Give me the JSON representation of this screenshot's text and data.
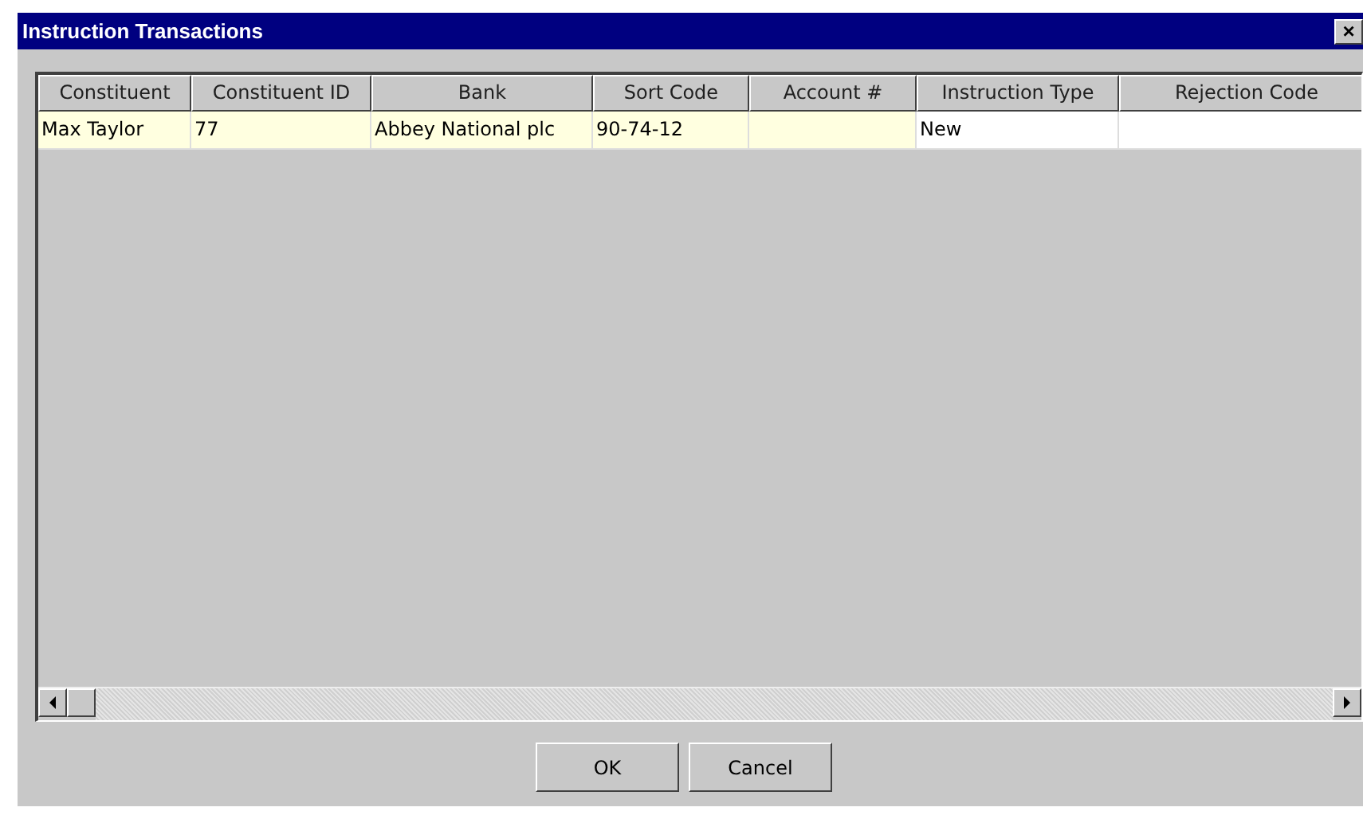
{
  "window": {
    "title": "Instruction Transactions",
    "close": "×"
  },
  "table": {
    "columns": [
      "Constituent",
      "Constituent ID",
      "Bank",
      "Sort Code",
      "Account #",
      "Instruction Type",
      "Rejection Code"
    ],
    "rows": [
      {
        "cells": [
          {
            "text": "Max Taylor",
            "readonly": true
          },
          {
            "text": "77",
            "readonly": true
          },
          {
            "text": "Abbey National plc",
            "readonly": true
          },
          {
            "text": "90-74-12",
            "readonly": true
          },
          {
            "text": "",
            "readonly": true
          },
          {
            "text": "New",
            "readonly": false
          },
          {
            "text": "",
            "readonly": false
          }
        ]
      }
    ]
  },
  "buttons": [
    "OK",
    "Cancel"
  ]
}
